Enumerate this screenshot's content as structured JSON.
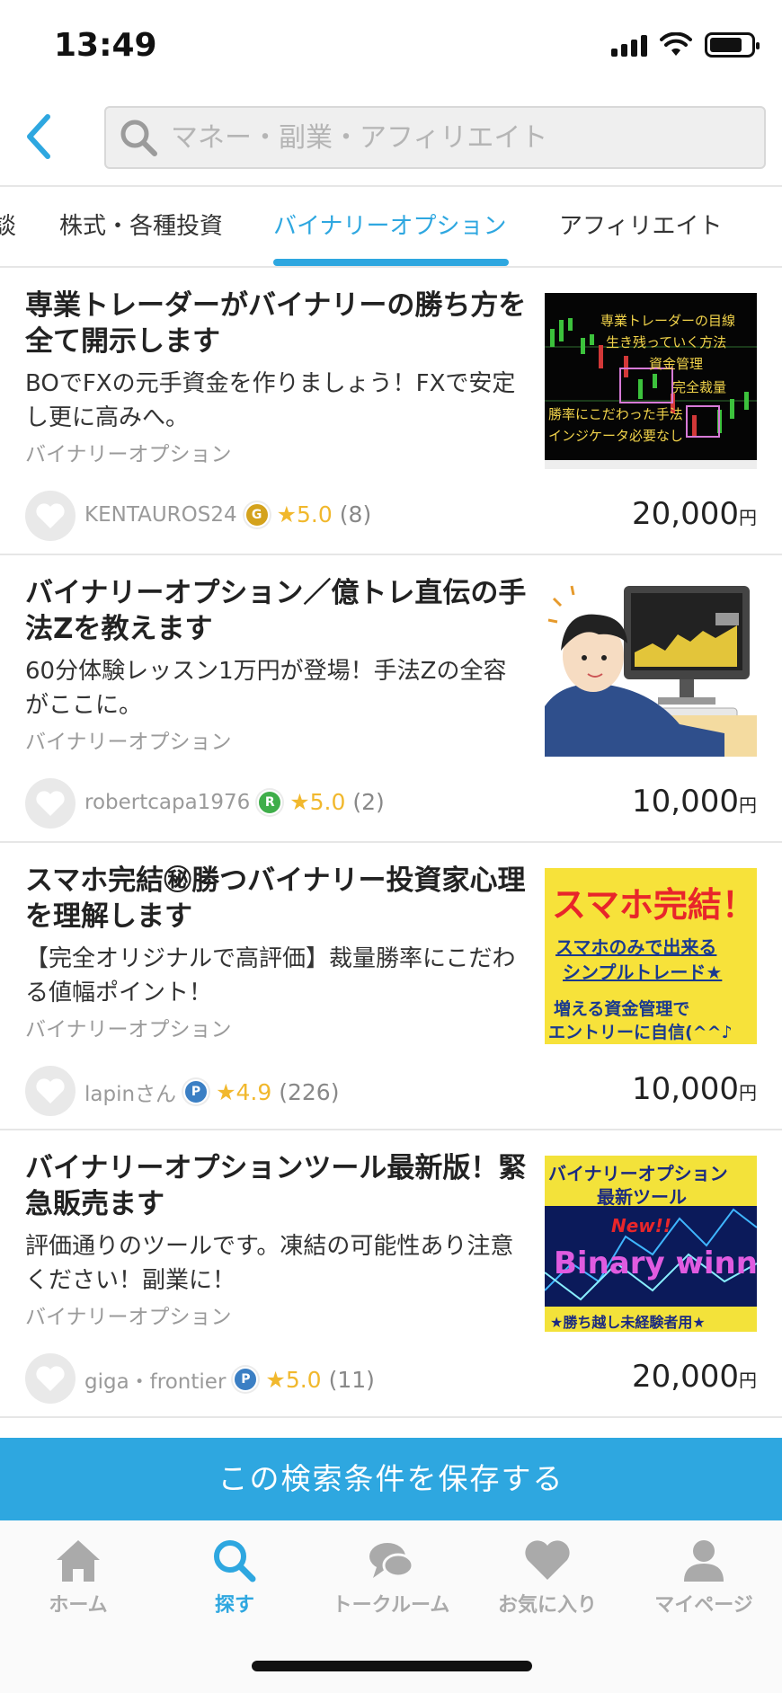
{
  "status": {
    "time": "13:49"
  },
  "search": {
    "placeholder": "マネー・副業・アフィリエイト"
  },
  "tabs": [
    {
      "label": "談"
    },
    {
      "label": "株式・各種投資"
    },
    {
      "label": "バイナリーオプション"
    },
    {
      "label": "アフィリエイト"
    }
  ],
  "listings": [
    {
      "title": "専業トレーダーがバイナリーの勝ち方を全て開示します",
      "desc": "BOでFXの元手資金を作りましょう！FXで安定し更に高みへ。",
      "category": "バイナリーオプション",
      "seller": "KENTAUROS24",
      "rank": "G",
      "rank_color": "#d4a21c",
      "rating": "★5.0",
      "reviews": "(8)",
      "price": "20,000",
      "price_unit": "円",
      "thumb": {
        "lines": [
          "専業トレーダーの目線",
          "生き残っていく方法",
          "資金管理",
          "完全裁量",
          "勝率にこだわった手法",
          "インジケータ必要なし"
        ]
      }
    },
    {
      "title": "バイナリーオプション／億トレ直伝の手法Zを教えます",
      "desc": "60分体験レッスン1万円が登場！手法Zの全容がここに。",
      "category": "バイナリーオプション",
      "seller": "robertcapa1976",
      "rank": "R",
      "rank_color": "#3fae4a",
      "rating": "★5.0",
      "reviews": "(2)",
      "price": "10,000",
      "price_unit": "円"
    },
    {
      "title": "スマホ完結㊙勝つバイナリー投資家心理を理解します",
      "desc": "【完全オリジナルで高評価】裁量勝率にこだわる値幅ポイント！",
      "category": "バイナリーオプション",
      "seller": "lapinさん",
      "rank": "P",
      "rank_color": "#3b7fc4",
      "rating": "★4.9",
      "reviews": "(226)",
      "price": "10,000",
      "price_unit": "円",
      "thumb": {
        "lines": [
          "スマホ完結！",
          "スマホのみで出来る",
          "シンプルトレード★",
          "増える資金管理で",
          "エントリーに自信(^^♪"
        ]
      }
    },
    {
      "title": "バイナリーオプションツール最新版！緊急販売ます",
      "desc": "評価通りのツールです。凍結の可能性あり注意ください！副業に！",
      "category": "バイナリーオプション",
      "seller": "giga・frontier",
      "rank": "P",
      "rank_color": "#3b7fc4",
      "rating": "★5.0",
      "reviews": "(11)",
      "price": "20,000",
      "price_unit": "円",
      "thumb": {
        "lines": [
          "バイナリーオプション",
          "最新ツール",
          "New!!",
          "Binary winner",
          "★勝ち越し未経験者用★"
        ]
      }
    }
  ],
  "save_button": {
    "label": "この検索条件を保存する"
  },
  "nav": [
    {
      "label": "ホーム",
      "icon": "home-icon"
    },
    {
      "label": "探す",
      "icon": "search-icon"
    },
    {
      "label": "トークルーム",
      "icon": "chat-icon"
    },
    {
      "label": "お気に入り",
      "icon": "heart-icon"
    },
    {
      "label": "マイページ",
      "icon": "person-icon"
    }
  ],
  "colors": {
    "accent": "#2ea7e0",
    "rating": "#f1b82d"
  }
}
